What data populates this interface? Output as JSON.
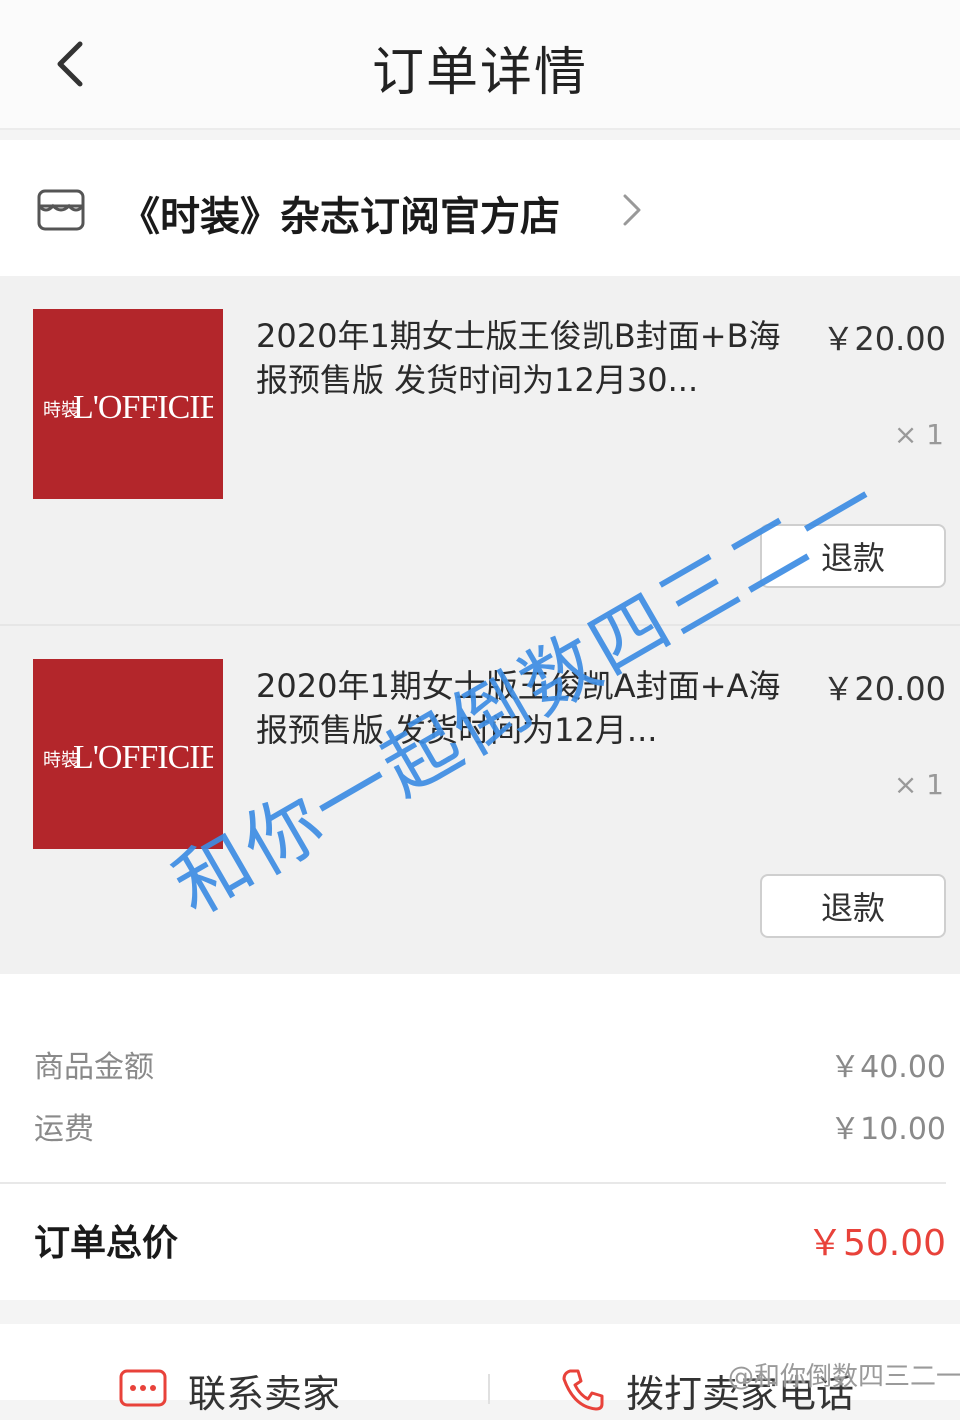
{
  "header": {
    "title": "订单详情",
    "back_icon": "chevron-left-icon"
  },
  "shop": {
    "name": "《时装》杂志订阅官方店",
    "icon": "store-icon",
    "chevron_icon": "chevron-right-icon"
  },
  "items": [
    {
      "thumb_text": "L'OFFICIEL",
      "thumb_cn": "時裝",
      "title": "2020年1期女士版王俊凯B封面+B海报预售版  发货时间为12月30...",
      "price": "￥20.00",
      "qty": "× 1",
      "refund_label": "退款"
    },
    {
      "thumb_text": "L'OFFICIEL",
      "thumb_cn": "時裝",
      "title": "2020年1期女士版王俊凯A封面+A海报预售版  发货时间为12月...",
      "price": "￥20.00",
      "qty": "× 1",
      "refund_label": "退款"
    }
  ],
  "summary": {
    "goods_label": "商品金额",
    "goods_value": "￥40.00",
    "shipping_label": "运费",
    "shipping_value": "￥10.00",
    "total_label": "订单总价",
    "total_value": "￥50.00"
  },
  "bottom": {
    "contact_label": "联系卖家",
    "call_label": "拨打卖家电话"
  },
  "overlay": {
    "watermark": "和你一起倒数四三二一",
    "weibo_mark": "@和你倒数四三二一"
  },
  "colors": {
    "accent": "#e8423a",
    "thumb_bg": "#b3262b",
    "watermark": "#3d8de3"
  }
}
